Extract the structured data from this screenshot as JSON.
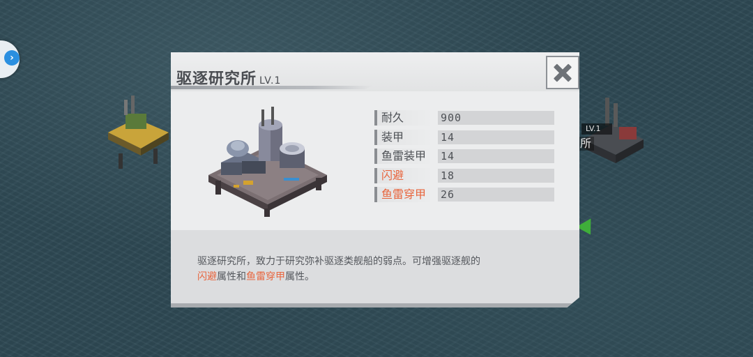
{
  "dialog": {
    "title": "驱逐研究所",
    "level": "LV.1",
    "stats": [
      {
        "label": "耐久",
        "value": "900",
        "highlight": false
      },
      {
        "label": "装甲",
        "value": "14",
        "highlight": false
      },
      {
        "label": "鱼雷装甲",
        "value": "14",
        "highlight": false
      },
      {
        "label": "闪避",
        "value": "18",
        "highlight": true
      },
      {
        "label": "鱼雷穿甲",
        "value": "26",
        "highlight": true
      }
    ],
    "description": {
      "line1": "驱逐研究所，致力于研究弥补驱逐类舰船的弱点。可增强驱逐舰的",
      "hl1": "闪避",
      "mid": "属性和",
      "hl2": "鱼雷穿甲",
      "end": "属性。"
    },
    "close_icon": "close-icon"
  },
  "background": {
    "level_tag": "LV.1",
    "name_fragment": "所",
    "side_icon": "chevron-right-icon"
  },
  "colors": {
    "highlight": "#e8643c",
    "text": "#4d5055",
    "ocean": "#2f4a55"
  }
}
